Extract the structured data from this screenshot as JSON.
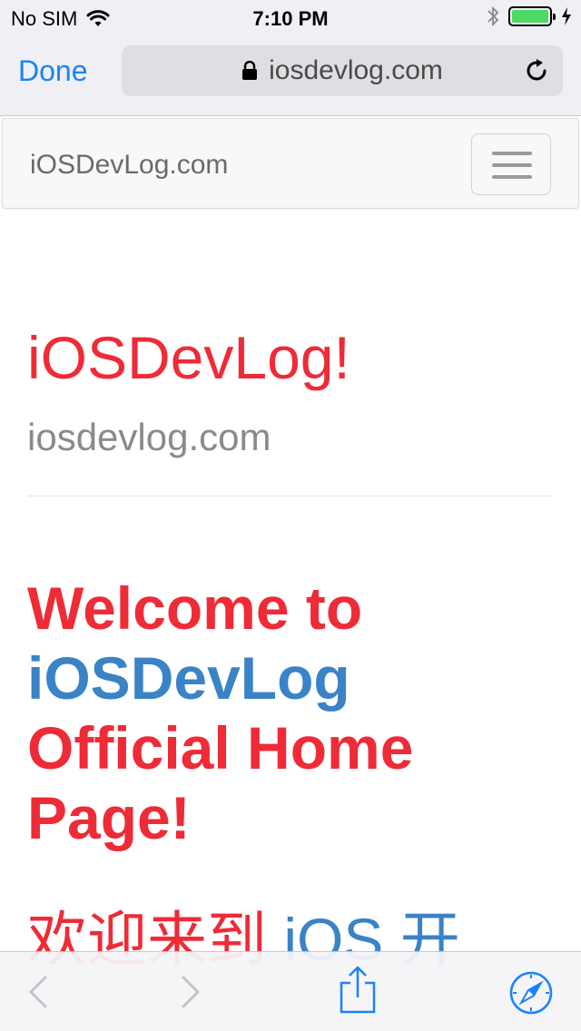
{
  "status_bar": {
    "carrier": "No SIM",
    "time": "7:10 PM",
    "icons": [
      "wifi-icon",
      "bluetooth-icon",
      "battery-icon",
      "charging-icon"
    ]
  },
  "browser": {
    "done_label": "Done",
    "url": "iosdevlog.com",
    "icons": [
      "lock-icon",
      "reload-icon"
    ]
  },
  "navbar": {
    "brand": "iOSDevLog.com",
    "toggle_icon": "hamburger-icon"
  },
  "content": {
    "heading": "iOSDevLog!",
    "subtitle": "iosdevlog.com",
    "welcome_prefix": "Welcome to",
    "welcome_highlight": "iOSDevLog",
    "welcome_suffix": "Official Home Page!",
    "chinese_prefix": "欢迎来到",
    "chinese_highlight": "iOS 开"
  },
  "bottom_toolbar": {
    "icons": [
      "back-icon",
      "forward-icon",
      "share-icon",
      "safari-compass-icon"
    ]
  },
  "colors": {
    "accent_red": "#ee2b37",
    "accent_blue": "#3a83c6",
    "ios_blue": "#1a82fb",
    "battery_green": "#4cd964"
  }
}
